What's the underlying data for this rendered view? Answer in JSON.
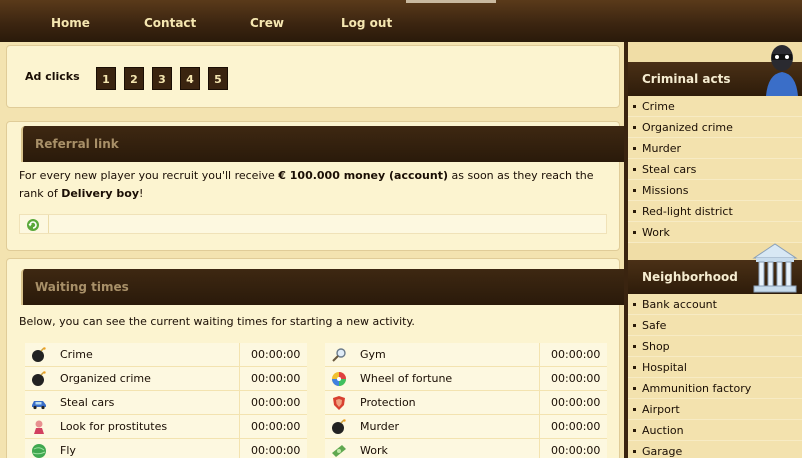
{
  "topnav": {
    "items": [
      "Home",
      "Contact",
      "Crew",
      "Log out"
    ]
  },
  "ads": {
    "label": "Ad clicks",
    "buttons": [
      "1",
      "2",
      "3",
      "4",
      "5"
    ]
  },
  "referral": {
    "title": "Referral link",
    "text_before": "For every new player you recruit you'll receive ",
    "reward": "€ 100.000 money (account)",
    "text_middle": " as soon as they reach the rank of ",
    "rank": "Delivery boy",
    "text_after": "!",
    "link_icon": "refresh-icon"
  },
  "waiting": {
    "title": "Waiting times",
    "intro": "Below, you can see the current waiting times for starting a new activity.",
    "left": [
      {
        "name": "Crime",
        "time": "00:00:00",
        "icon": "bomb-icon"
      },
      {
        "name": "Organized crime",
        "time": "00:00:00",
        "icon": "bomb-icon"
      },
      {
        "name": "Steal cars",
        "time": "00:00:00",
        "icon": "car-icon"
      },
      {
        "name": "Look for prostitutes",
        "time": "00:00:00",
        "icon": "woman-icon"
      },
      {
        "name": "Fly",
        "time": "00:00:00",
        "icon": "globe-icon"
      }
    ],
    "right": [
      {
        "name": "Gym",
        "time": "00:00:00",
        "icon": "magnifier-icon"
      },
      {
        "name": "Wheel of fortune",
        "time": "00:00:00",
        "icon": "wheel-icon"
      },
      {
        "name": "Protection",
        "time": "00:00:00",
        "icon": "shield-icon"
      },
      {
        "name": "Murder",
        "time": "00:00:00",
        "icon": "bomb-icon"
      },
      {
        "name": "Work",
        "time": "00:00:00",
        "icon": "money-icon"
      }
    ]
  },
  "sidebar": {
    "criminal": {
      "title": "Criminal acts",
      "icon": "thief-icon",
      "items": [
        "Crime",
        "Organized crime",
        "Murder",
        "Steal cars",
        "Missions",
        "Red-light district",
        "Work"
      ]
    },
    "neighborhood": {
      "title": "Neighborhood",
      "icon": "bank-building-icon",
      "items": [
        "Bank account",
        "Safe",
        "Shop",
        "Hospital",
        "Ammunition factory",
        "Airport",
        "Auction",
        "Garage"
      ]
    }
  }
}
